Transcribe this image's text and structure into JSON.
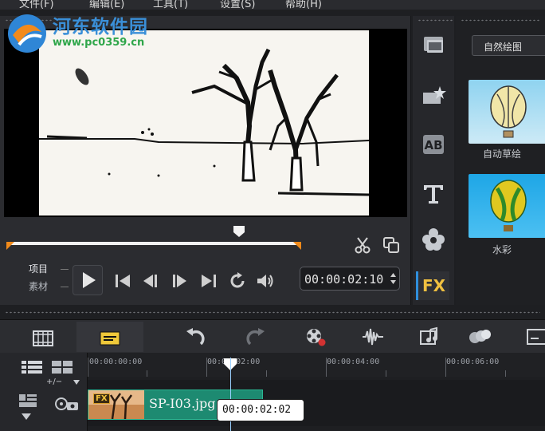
{
  "menubar": {
    "items": [
      {
        "label": "文件(F)"
      },
      {
        "label": "编辑(E)"
      },
      {
        "label": "工具(T)"
      },
      {
        "label": "设置(S)"
      },
      {
        "label": "帮助(H)"
      }
    ]
  },
  "watermark": {
    "title": "河东软件园",
    "url": "www.pc0359.cn"
  },
  "player": {
    "mode_project": "项目",
    "mode_clip": "素材",
    "timecode": "00:00:02:10",
    "scrub_position_percent": 79
  },
  "gallery": {
    "category": "自然绘图",
    "items": [
      {
        "label": "自动草绘"
      },
      {
        "label": "水彩"
      }
    ]
  },
  "side_toolbar": {
    "fx_label": "FX"
  },
  "timeline": {
    "track_controls": "+/−",
    "ruler_labels": [
      "00:00:00:00",
      "00:00:02:00",
      "00:00:04:00",
      "00:00:06:00"
    ],
    "clip": {
      "name": "SP-I03.jpg",
      "fx_badge": "FX"
    },
    "tooltip": "00:00:02:02"
  },
  "colors": {
    "accent": "#2f8fdc",
    "trim": "#f08a1a",
    "clip": "#1d8a71",
    "fx": "#f0c040"
  }
}
